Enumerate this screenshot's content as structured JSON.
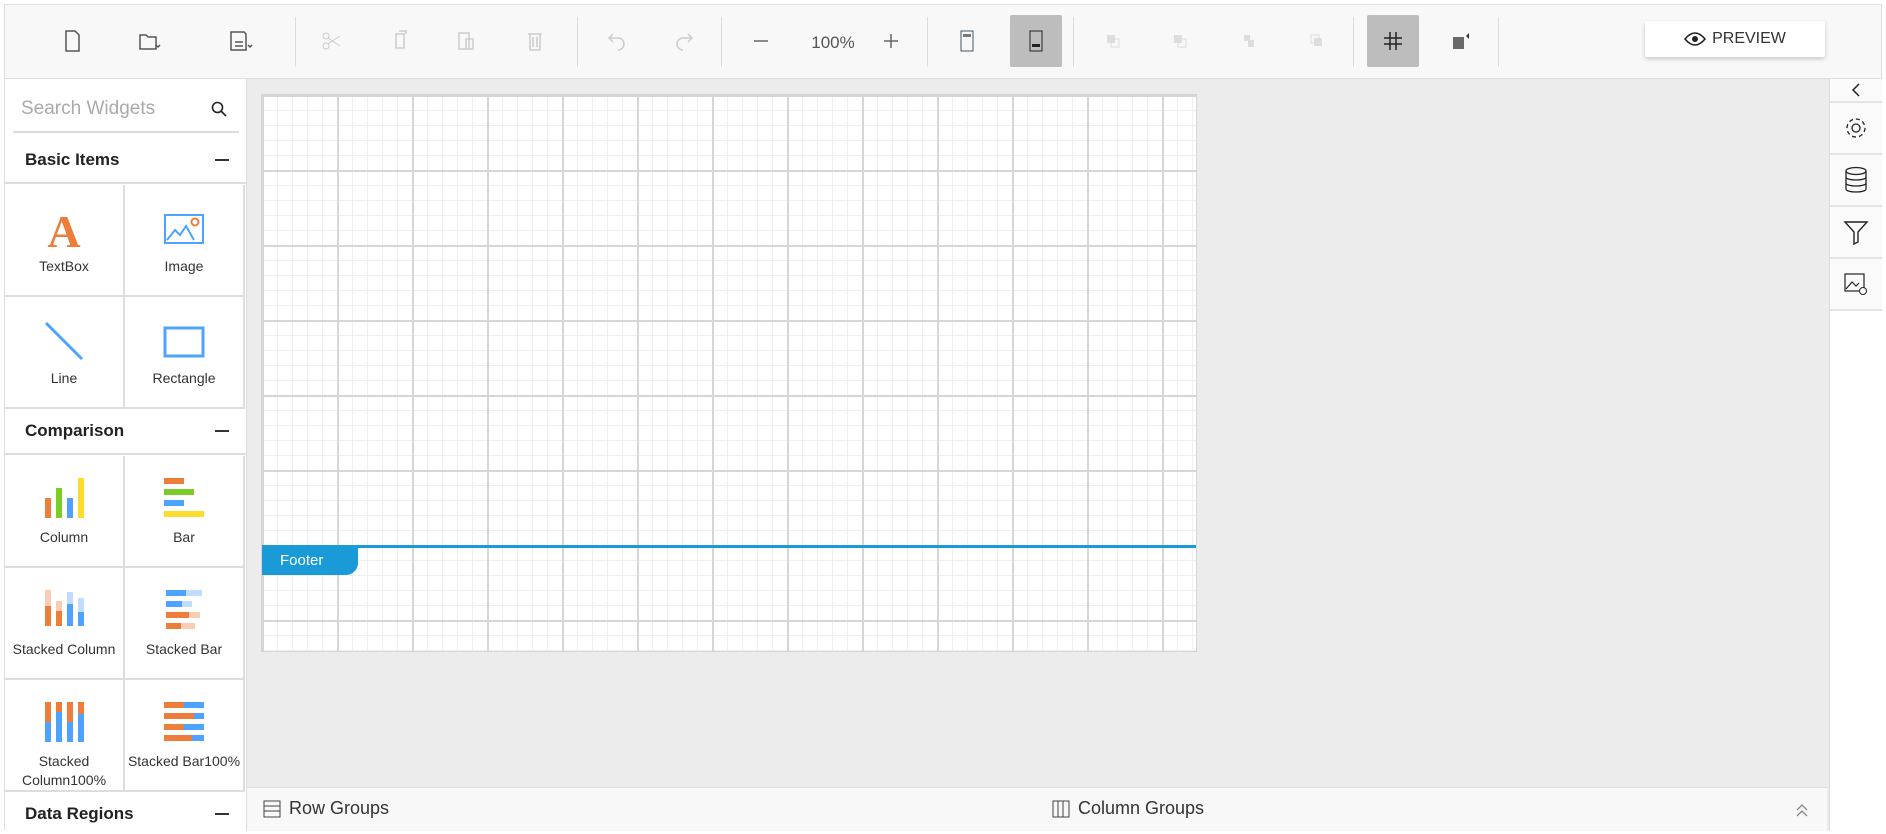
{
  "toolbar": {
    "zoom_value": "100%",
    "preview_label": "PREVIEW",
    "buttons": [
      "new-icon",
      "open-icon",
      "save-icon",
      "cut-icon",
      "copy-icon",
      "paste-icon",
      "delete-icon",
      "undo-icon",
      "redo-icon",
      "zoom-out-icon",
      "zoom-in-icon",
      "header-icon",
      "footer-icon",
      "bring-forward-icon",
      "send-backward-icon",
      "bring-to-front-icon",
      "send-to-back-icon",
      "grid-icon",
      "snap-icon"
    ]
  },
  "left_panel": {
    "search_placeholder": "Search Widgets",
    "sections": [
      {
        "title": "Basic Items",
        "items": [
          "TextBox",
          "Image",
          "Line",
          "Rectangle"
        ]
      },
      {
        "title": "Comparison",
        "items": [
          "Column",
          "Bar",
          "Stacked Column",
          "Stacked Bar",
          "Stacked Column100%",
          "Stacked Bar100%"
        ]
      },
      {
        "title": "Data Regions"
      }
    ]
  },
  "canvas": {
    "footer_label": "Footer"
  },
  "bottom": {
    "row_groups": "Row Groups",
    "column_groups": "Column Groups"
  },
  "colors": {
    "accent": "#1a9bd7",
    "orange": "#ed7d3a",
    "blue": "#4da3ff",
    "green": "#7ccc2a",
    "yellow": "#fcdc2c"
  }
}
